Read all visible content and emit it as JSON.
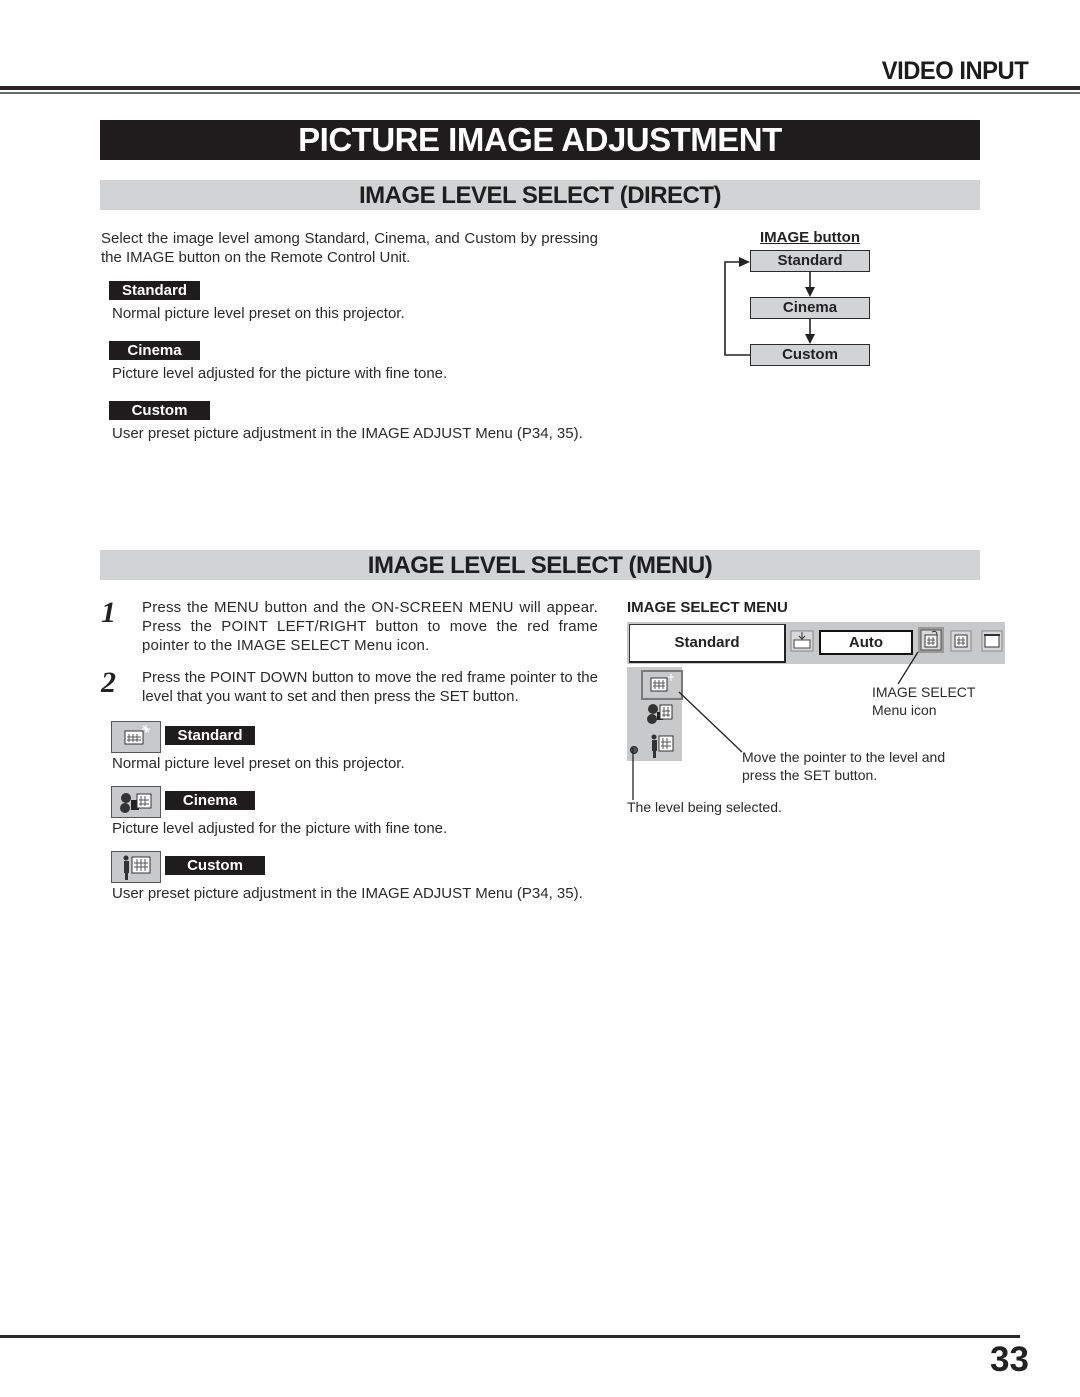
{
  "header": {
    "section": "VIDEO INPUT",
    "title": "PICTURE IMAGE ADJUSTMENT"
  },
  "direct": {
    "heading": "IMAGE LEVEL SELECT (DIRECT)",
    "intro": "Select the image level among Standard, Cinema, and Custom by pressing the IMAGE button on  the Remote Control Unit.",
    "levels": [
      {
        "label": "Standard",
        "desc": "Normal picture level preset on this projector."
      },
      {
        "label": "Cinema",
        "desc": "Picture level adjusted for the picture with fine tone."
      },
      {
        "label": "Custom",
        "desc": "User preset picture adjustment in the IMAGE ADJUST Menu (P34, 35)."
      }
    ],
    "flow": {
      "title": "IMAGE button",
      "steps": [
        "Standard",
        "Cinema",
        "Custom"
      ]
    }
  },
  "menu": {
    "heading": "IMAGE LEVEL SELECT (MENU)",
    "steps": [
      {
        "num": "1",
        "text": "Press the MENU button and the ON-SCREEN MENU will appear.  Press the POINT LEFT/RIGHT button to move the red frame pointer to the IMAGE SELECT Menu icon."
      },
      {
        "num": "2",
        "text": "Press the POINT DOWN button to move the red frame pointer to the level that you want to set and then press the SET button."
      }
    ],
    "levels": [
      {
        "label": "Standard",
        "icon": "standard-image-icon",
        "desc": "Normal picture level preset on this projector."
      },
      {
        "label": "Cinema",
        "icon": "cinema-film-icon",
        "desc": "Picture level adjusted for the picture with fine tone."
      },
      {
        "label": "Custom",
        "icon": "custom-person-icon",
        "desc": "User preset picture adjustment in the IMAGE ADJUST Menu (P34, 35)."
      }
    ],
    "osd": {
      "title": "IMAGE SELECT MENU",
      "current_level": "Standard",
      "mode": "Auto",
      "callout_icon_line1": "IMAGE SELECT",
      "callout_icon_line2": "Menu icon",
      "callout_pointer_line1": "Move the pointer to the level and",
      "callout_pointer_line2": "press the SET button.",
      "callout_selected": "The level being selected."
    }
  },
  "footer": {
    "page_number": "33"
  }
}
